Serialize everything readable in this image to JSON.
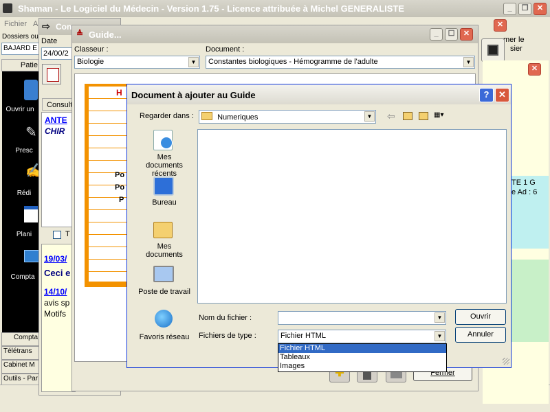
{
  "main_window": {
    "title": "Shaman - Le Logiciel du Médecin - Version 1.75 - Licence attribuée à Michel GENERALISTE",
    "menu": [
      "Fichier",
      "A"
    ],
    "dossiers_label": "Dossiers ou",
    "patient_name": "BAJARD E",
    "patient_tab": "Patie",
    "nav": [
      "Ouvrir un",
      "Presc",
      "Rédi",
      "Plani",
      "Compta"
    ],
    "bottom_tabs": [
      "Compta",
      "Télétrans",
      "Cabinet M",
      "Outils - Par"
    ]
  },
  "consult_window": {
    "title": "Con",
    "date_label": "Date",
    "date_value": "24/00/2",
    "tab": "Consult",
    "history": [
      "ANTE",
      "CHIR"
    ],
    "entries": [
      {
        "date": "19/03/",
        "text": "Ceci e"
      },
      {
        "date": "14/10/",
        "text": "avis sp",
        "extra": "Motifs"
      }
    ],
    "checkbox_label": "T"
  },
  "right_window": {
    "text1": "mer le",
    "text2": "sier",
    "info1": "TE 1 G",
    "info2": "e Ad : 6"
  },
  "guide_window": {
    "title": "Guide...",
    "classeur_label": "Classeur :",
    "classeur_value": "Biologie",
    "document_label": "Document :",
    "document_value": "Constantes biologiques - Hémogramme de l'adulte",
    "preview_labels": [
      "H",
      "Po",
      "Po",
      "P"
    ],
    "fermer_label": "Fermer"
  },
  "dialog": {
    "title": "Document à ajouter au Guide",
    "look_in_label": "Regarder dans :",
    "look_in_value": "Numeriques",
    "places": [
      {
        "label": "Mes documents récents",
        "icon": "recent-documents-icon"
      },
      {
        "label": "Bureau",
        "icon": "desktop-icon"
      },
      {
        "label": "Mes documents",
        "icon": "my-documents-icon"
      },
      {
        "label": "Poste de travail",
        "icon": "my-computer-icon"
      },
      {
        "label": "Favoris réseau",
        "icon": "network-places-icon"
      }
    ],
    "filename_label": "Nom du fichier :",
    "filename_value": "",
    "filetype_label": "Fichiers de type :",
    "filetype_value": "Fichier HTML",
    "filetype_options": [
      "Fichier HTML",
      "Tableaux",
      "Images"
    ],
    "open_button": "Ouvrir",
    "cancel_button": "Annuler",
    "help_button": "?"
  }
}
